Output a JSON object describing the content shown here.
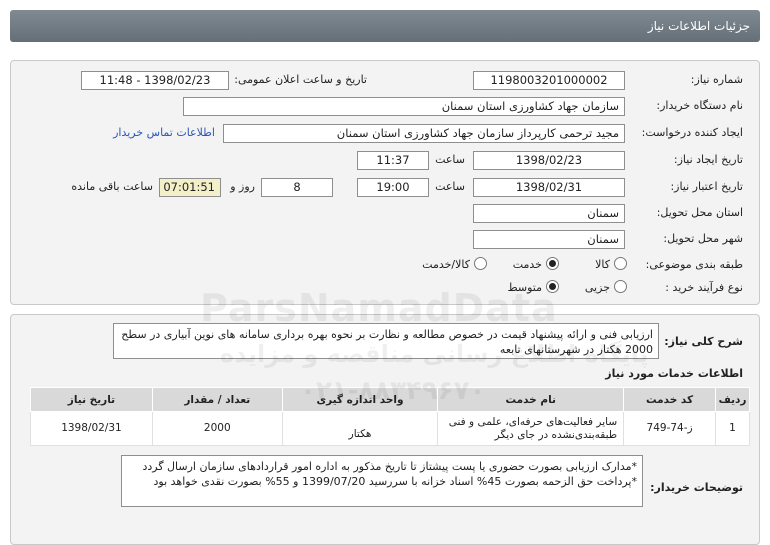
{
  "header": {
    "title": "جزئیات اطلاعات نیاز"
  },
  "info": {
    "need_number_label": "شماره نیاز:",
    "need_number": "1198003201000002",
    "announce_label": "تاریخ و ساعت اعلان عمومی:",
    "announce_value": "1398/02/23 - 11:48",
    "buyer_org_label": "نام دستگاه خریدار:",
    "buyer_org": "سازمان جهاد کشاورزی استان سمنان",
    "requester_label": "ایجاد کننده درخواست:",
    "requester": "مجید ترحمی کارپرداز سازمان جهاد کشاورزی استان سمنان",
    "contact_link": "اطلاعات تماس خریدار",
    "created_label": "تاریخ ایجاد نیاز:",
    "created_date": "1398/02/23",
    "time_label": "ساعت",
    "created_time": "11:37",
    "valid_label": "تاریخ اعتبار نیاز:",
    "valid_date": "1398/02/31",
    "valid_time": "19:00",
    "days_value": "8",
    "days_label": "روز و",
    "remaining_time": "07:01:51",
    "remaining_label": "ساعت باقی مانده",
    "province_label": "استان محل تحویل:",
    "province": "سمنان",
    "city_label": "شهر محل تحویل:",
    "city": "سمنان",
    "category_label": "طبقه بندی موضوعی:",
    "category_options": [
      "کالا",
      "خدمت",
      "کالا/خدمت"
    ],
    "category_selected": "خدمت",
    "process_label": "نوع فرآیند خرید :",
    "process_options": [
      "جزیی",
      "متوسط"
    ],
    "process_selected": "متوسط"
  },
  "details": {
    "summary_label": "شرح کلی نیاز:",
    "summary": "ارزیابی فنی و ارائه پیشنهاد قیمت در خصوص مطالعه و نظارت بر نحوه بهره برداری سامانه های نوین آبیاری در سطح 2000 هکتار در شهرستانهای تابعه",
    "services_title": "اطلاعات خدمات مورد نیاز",
    "table": {
      "headers": [
        "ردیف",
        "کد خدمت",
        "نام خدمت",
        "واحد اندازه گیری",
        "تعداد / مقدار",
        "تاریخ نیاز"
      ],
      "rows": [
        {
          "row": "1",
          "code": "ز-74-749",
          "name": "سایر فعالیت‌های حرفه‌ای، علمی و فنی طبقه‌بندی‌نشده در جای دیگر",
          "unit": "هکتار",
          "qty": "2000",
          "date": "1398/02/31"
        }
      ]
    },
    "notes_label": "توضیحات خریدار:",
    "notes_line1": "*مدارک ارزیابی بصورت حضوری یا پست پیشتاز تا تاریخ مذکور به اداره امور قراردادهای سازمان ارسال گردد",
    "notes_line2": "*پرداخت حق الزحمه بصورت 45% اسناد خزانه با سررسید 1399/07/20 و 55% بصورت نقدی خواهد بود"
  },
  "watermark": {
    "brand": "ParsNamadData",
    "line1": "پایگاه اطلاع رسانی مناقصه و مزایده",
    "phone": "۰۲۱-۸۸۳۴۹۶۷۰"
  }
}
